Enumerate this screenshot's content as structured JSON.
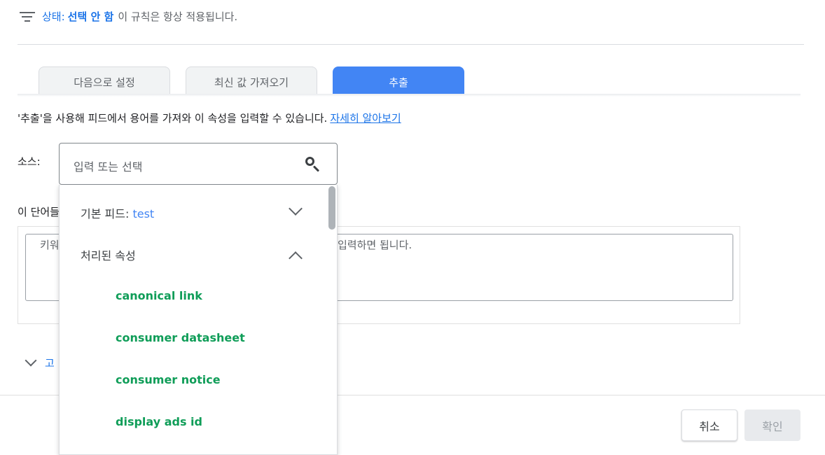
{
  "filter": {
    "status_label": "상태:",
    "status_value": "선택 안 함",
    "description": "이 규칙은 항상 적용됩니다."
  },
  "tabs": [
    {
      "label": "다음으로 설정"
    },
    {
      "label": "최신 값 가져오기"
    },
    {
      "label": "추출",
      "active": true
    }
  ],
  "help": {
    "text": "'추출'을 사용해 피드에서 용어를 가져와 이 속성을 입력할 수 있습니다.",
    "link": "자세히 알아보기"
  },
  "source": {
    "label": "소스:",
    "placeholder": "입력 또는 선택"
  },
  "words_label": "이 단어들",
  "keywords_placeholder_visible_start": "키워",
  "keywords_placeholder_visible_end": "입력하면 됩니다.",
  "advanced_label_visible": "고",
  "dropdown": {
    "base_feed_label": "기본 피드:",
    "base_feed_value": "test",
    "processed_label": "처리된 속성",
    "items": [
      "canonical link",
      "consumer datasheet",
      "consumer notice",
      "display ads id"
    ]
  },
  "footer": {
    "cancel": "취소",
    "confirm": "확인"
  },
  "colors": {
    "accent": "#1a73e8",
    "tab_active": "#4285f4",
    "item_green": "#0f9d58"
  }
}
